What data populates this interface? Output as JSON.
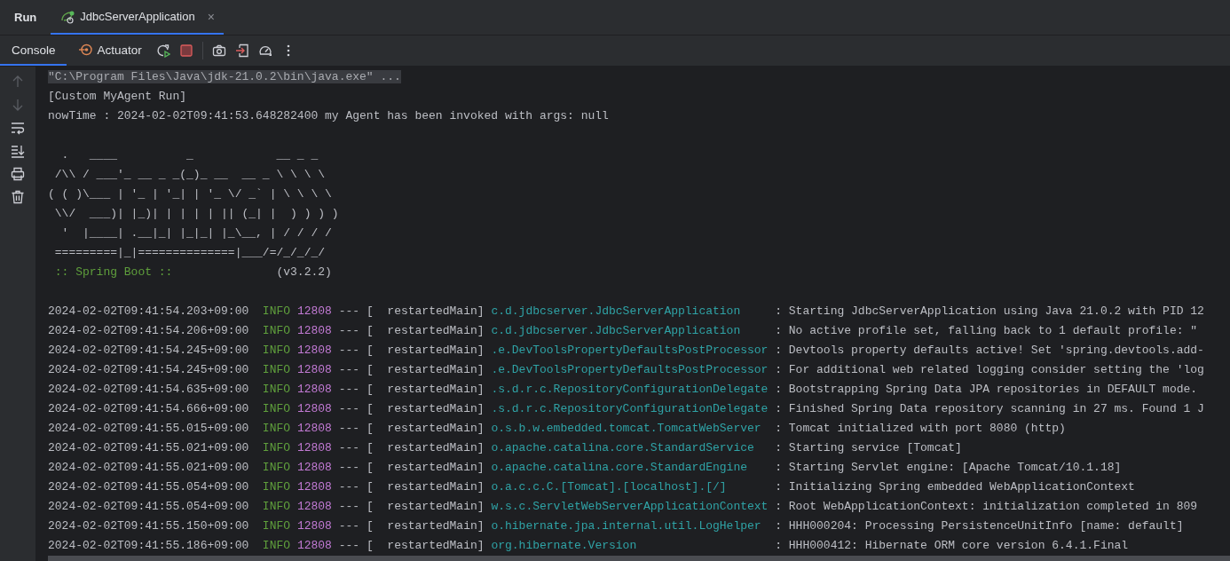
{
  "tool_window": {
    "title": "Run"
  },
  "run_tabs": [
    {
      "label": "JdbcServerApplication",
      "selected": true,
      "close": "×"
    }
  ],
  "console_tabs": [
    {
      "label": "Console",
      "selected": true,
      "kind": "console"
    },
    {
      "label": "Actuator",
      "selected": false,
      "kind": "actuator"
    }
  ],
  "gutter_tools": [
    {
      "kind": "up",
      "disabled": true
    },
    {
      "kind": "down",
      "disabled": true
    },
    {
      "kind": "wrap",
      "disabled": false
    },
    {
      "kind": "scroll-end",
      "disabled": false
    },
    {
      "kind": "print",
      "disabled": false
    },
    {
      "kind": "clear",
      "disabled": false
    }
  ],
  "console": {
    "command_line": "\"C:\\Program Files\\Java\\jdk-21.0.2\\bin\\java.exe\" ...",
    "output_lines": [
      "[Custom MyAgent Run]",
      "nowTime : 2024-02-02T09:41:53.648282400 my Agent has been invoked with args: null"
    ],
    "banner": [
      "  .   ____          _            __ _ _",
      " /\\\\ / ___'_ __ _ _(_)_ __  __ _ \\ \\ \\ \\",
      "( ( )\\___ | '_ | '_| | '_ \\/ _` | \\ \\ \\ \\",
      " \\\\/  ___)| |_)| | | | | || (_| |  ) ) ) )",
      "  '  |____| .__|_| |_|_| |_\\__, | / / / /",
      " =========|_|==============|___/=/_/_/_/"
    ],
    "spring_boot_label": " :: Spring Boot :: ",
    "spring_boot_version": "(v3.2.2)",
    "log_rows": [
      {
        "timestamp": "2024-02-02T09:41:54.203+09:00",
        "level": "INFO",
        "pid": "12808",
        "separator": "---",
        "thread": "[  restartedMain]",
        "logger": "c.d.jdbcserver.JdbcServerApplication",
        "message": ": Starting JdbcServerApplication using Java 21.0.2 with PID 12"
      },
      {
        "timestamp": "2024-02-02T09:41:54.206+09:00",
        "level": "INFO",
        "pid": "12808",
        "separator": "---",
        "thread": "[  restartedMain]",
        "logger": "c.d.jdbcserver.JdbcServerApplication",
        "message": ": No active profile set, falling back to 1 default profile: \""
      },
      {
        "timestamp": "2024-02-02T09:41:54.245+09:00",
        "level": "INFO",
        "pid": "12808",
        "separator": "---",
        "thread": "[  restartedMain]",
        "logger": ".e.DevToolsPropertyDefaultsPostProcessor",
        "message": ": Devtools property defaults active! Set 'spring.devtools.add-"
      },
      {
        "timestamp": "2024-02-02T09:41:54.245+09:00",
        "level": "INFO",
        "pid": "12808",
        "separator": "---",
        "thread": "[  restartedMain]",
        "logger": ".e.DevToolsPropertyDefaultsPostProcessor",
        "message": ": For additional web related logging consider setting the 'log"
      },
      {
        "timestamp": "2024-02-02T09:41:54.635+09:00",
        "level": "INFO",
        "pid": "12808",
        "separator": "---",
        "thread": "[  restartedMain]",
        "logger": ".s.d.r.c.RepositoryConfigurationDelegate",
        "message": ": Bootstrapping Spring Data JPA repositories in DEFAULT mode."
      },
      {
        "timestamp": "2024-02-02T09:41:54.666+09:00",
        "level": "INFO",
        "pid": "12808",
        "separator": "---",
        "thread": "[  restartedMain]",
        "logger": ".s.d.r.c.RepositoryConfigurationDelegate",
        "message": ": Finished Spring Data repository scanning in 27 ms. Found 1 J"
      },
      {
        "timestamp": "2024-02-02T09:41:55.015+09:00",
        "level": "INFO",
        "pid": "12808",
        "separator": "---",
        "thread": "[  restartedMain]",
        "logger": "o.s.b.w.embedded.tomcat.TomcatWebServer",
        "message": ": Tomcat initialized with port 8080 (http)"
      },
      {
        "timestamp": "2024-02-02T09:41:55.021+09:00",
        "level": "INFO",
        "pid": "12808",
        "separator": "---",
        "thread": "[  restartedMain]",
        "logger": "o.apache.catalina.core.StandardService",
        "message": ": Starting service [Tomcat]"
      },
      {
        "timestamp": "2024-02-02T09:41:55.021+09:00",
        "level": "INFO",
        "pid": "12808",
        "separator": "---",
        "thread": "[  restartedMain]",
        "logger": "o.apache.catalina.core.StandardEngine",
        "message": ": Starting Servlet engine: [Apache Tomcat/10.1.18]"
      },
      {
        "timestamp": "2024-02-02T09:41:55.054+09:00",
        "level": "INFO",
        "pid": "12808",
        "separator": "---",
        "thread": "[  restartedMain]",
        "logger": "o.a.c.c.C.[Tomcat].[localhost].[/]",
        "message": ": Initializing Spring embedded WebApplicationContext"
      },
      {
        "timestamp": "2024-02-02T09:41:55.054+09:00",
        "level": "INFO",
        "pid": "12808",
        "separator": "---",
        "thread": "[  restartedMain]",
        "logger": "w.s.c.ServletWebServerApplicationContext",
        "message": ": Root WebApplicationContext: initialization completed in 809"
      },
      {
        "timestamp": "2024-02-02T09:41:55.150+09:00",
        "level": "INFO",
        "pid": "12808",
        "separator": "---",
        "thread": "[  restartedMain]",
        "logger": "o.hibernate.jpa.internal.util.LogHelper",
        "message": ": HHH000204: Processing PersistenceUnitInfo [name: default]"
      },
      {
        "timestamp": "2024-02-02T09:41:55.186+09:00",
        "level": "INFO",
        "pid": "12808",
        "separator": "---",
        "thread": "[  restartedMain]",
        "logger": "org.hibernate.Version",
        "message": ": HHH000412: Hibernate ORM core version 6.4.1.Final"
      }
    ]
  }
}
